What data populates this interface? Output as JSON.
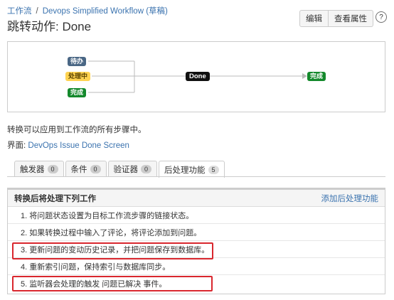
{
  "breadcrumb": {
    "root": "工作流",
    "separator": "/",
    "workflow": "Devops Simplified Workflow (草稿)"
  },
  "title": "跳转动作: Done",
  "actions": {
    "edit": "编辑",
    "view_props": "查看属性",
    "help": "?"
  },
  "diagram": {
    "statuses": [
      {
        "label": "待办",
        "color": "#4a6785"
      },
      {
        "label": "处理中",
        "color": "#ffd351"
      },
      {
        "label": "完成",
        "color": "#14892c"
      }
    ],
    "transition": "Done",
    "target": {
      "label": "完成",
      "color": "#14892c"
    }
  },
  "description": "转换可以应用到工作流的所有步骤中。",
  "screen": {
    "label": "界面:",
    "value": "DevOps Issue Done Screen"
  },
  "tabs": [
    {
      "label": "触发器",
      "count": "0"
    },
    {
      "label": "条件",
      "count": "0"
    },
    {
      "label": "验证器",
      "count": "0"
    },
    {
      "label": "后处理功能",
      "count": "5"
    }
  ],
  "panel": {
    "title": "转换后将处理下列工作",
    "add_link": "添加后处理功能",
    "items": [
      "1.  将问题状态设置为目标工作流步骤的链接状态。",
      "2.  如果转换过程中输入了评论，将评论添加到问题。",
      "3.  更新问题的变动历史记录，并把问题保存到数据库。",
      "4.  重新索引问题，保持索引与数据库同步。",
      "5.  监听器会处理的触发 问题已解决 事件。"
    ]
  },
  "colors": {
    "highlight": "#d9272e",
    "link": "#3b73af"
  }
}
